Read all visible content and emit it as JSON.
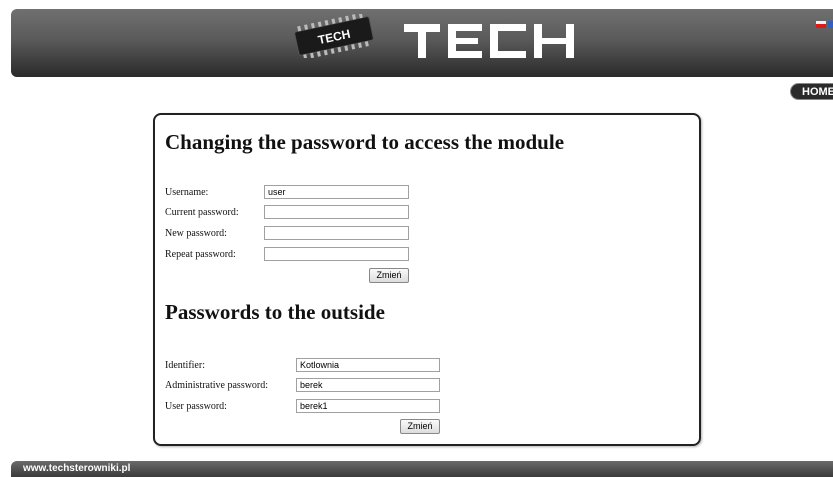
{
  "header": {
    "chip_text": "TECH",
    "logo_text": "TECH",
    "flag": "pl-flag-icon",
    "flag_next": "uk-flag-icon"
  },
  "nav": {
    "home_label": "HOME"
  },
  "password_section": {
    "title": "Changing the password to access the module",
    "username_label": "Username:",
    "username_value": "user",
    "current_password_label": "Current password:",
    "current_password_value": "",
    "new_password_label": "New password:",
    "new_password_value": "",
    "repeat_password_label": "Repeat password:",
    "repeat_password_value": "",
    "submit_label": "Zmień"
  },
  "outside_section": {
    "title": "Passwords to the outside",
    "identifier_label": "Identifier:",
    "identifier_value": "Kotlownia",
    "admin_password_label": "Administrative password:",
    "admin_password_value": "berek",
    "user_password_label": "User password:",
    "user_password_value": "berek1",
    "submit_label": "Zmień"
  },
  "footer": {
    "site": "www.techsterowniki.pl"
  }
}
